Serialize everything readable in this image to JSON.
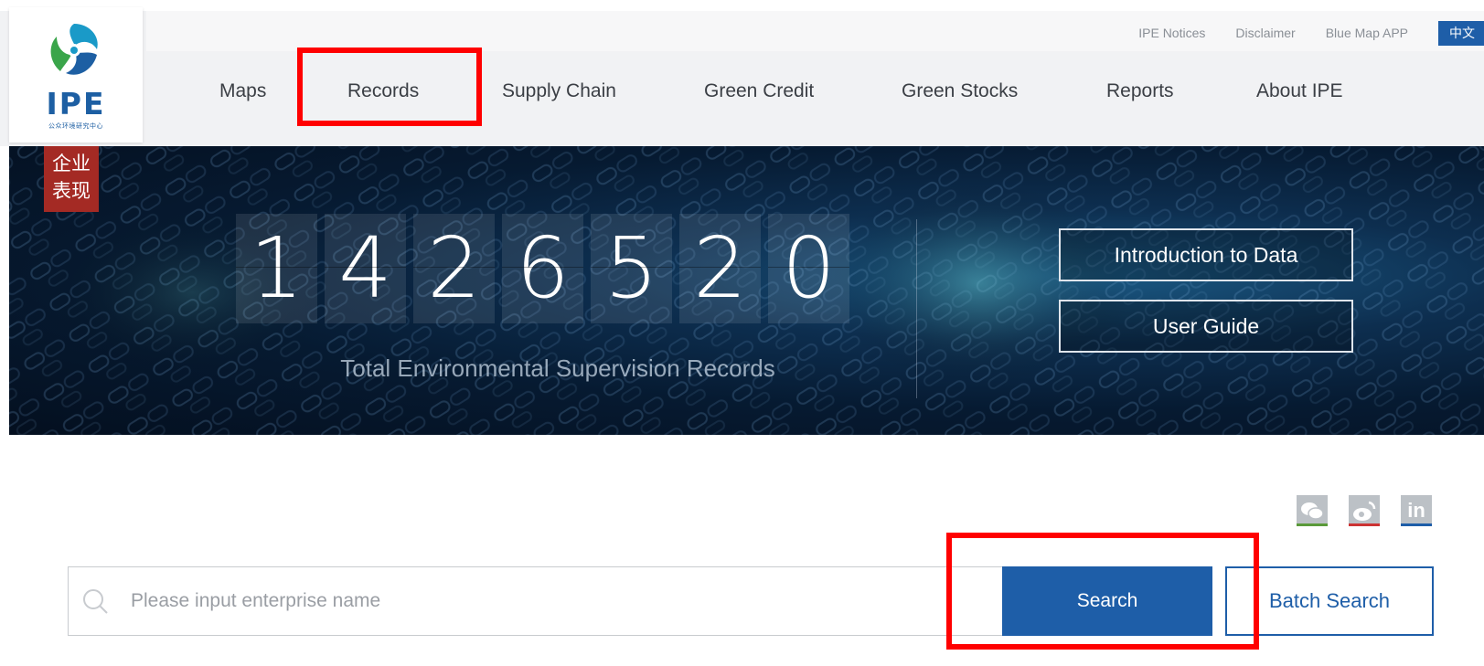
{
  "logo": {
    "text": "IPE",
    "subtitle": "公众环境研究中心"
  },
  "toplinks": {
    "notices": "IPE Notices",
    "disclaimer": "Disclaimer",
    "app": "Blue Map APP",
    "language": "中文"
  },
  "nav": {
    "items": [
      {
        "label": "Maps"
      },
      {
        "label": "Records"
      },
      {
        "label": "Supply Chain"
      },
      {
        "label": "Green Credit"
      },
      {
        "label": "Green Stocks"
      },
      {
        "label": "Reports"
      },
      {
        "label": "About IPE"
      }
    ]
  },
  "banner": {
    "badge": "企业\n表现",
    "digits": [
      "1",
      "4",
      "2",
      "6",
      "5",
      "2",
      "0"
    ],
    "caption": "Total Environmental Supervision Records",
    "intro_button": "Introduction to Data",
    "guide_button": "User Guide"
  },
  "social": {
    "icons": [
      "wechat-icon",
      "weibo-icon",
      "linkedin-icon"
    ],
    "linkedin_text": "in"
  },
  "search": {
    "placeholder": "Please input enterprise name",
    "value": "",
    "button": "Search",
    "batch_button": "Batch Search"
  },
  "colors": {
    "brand_blue": "#1e5ea8",
    "badge_red": "#a42a24",
    "highlight_red": "#ff0000"
  }
}
